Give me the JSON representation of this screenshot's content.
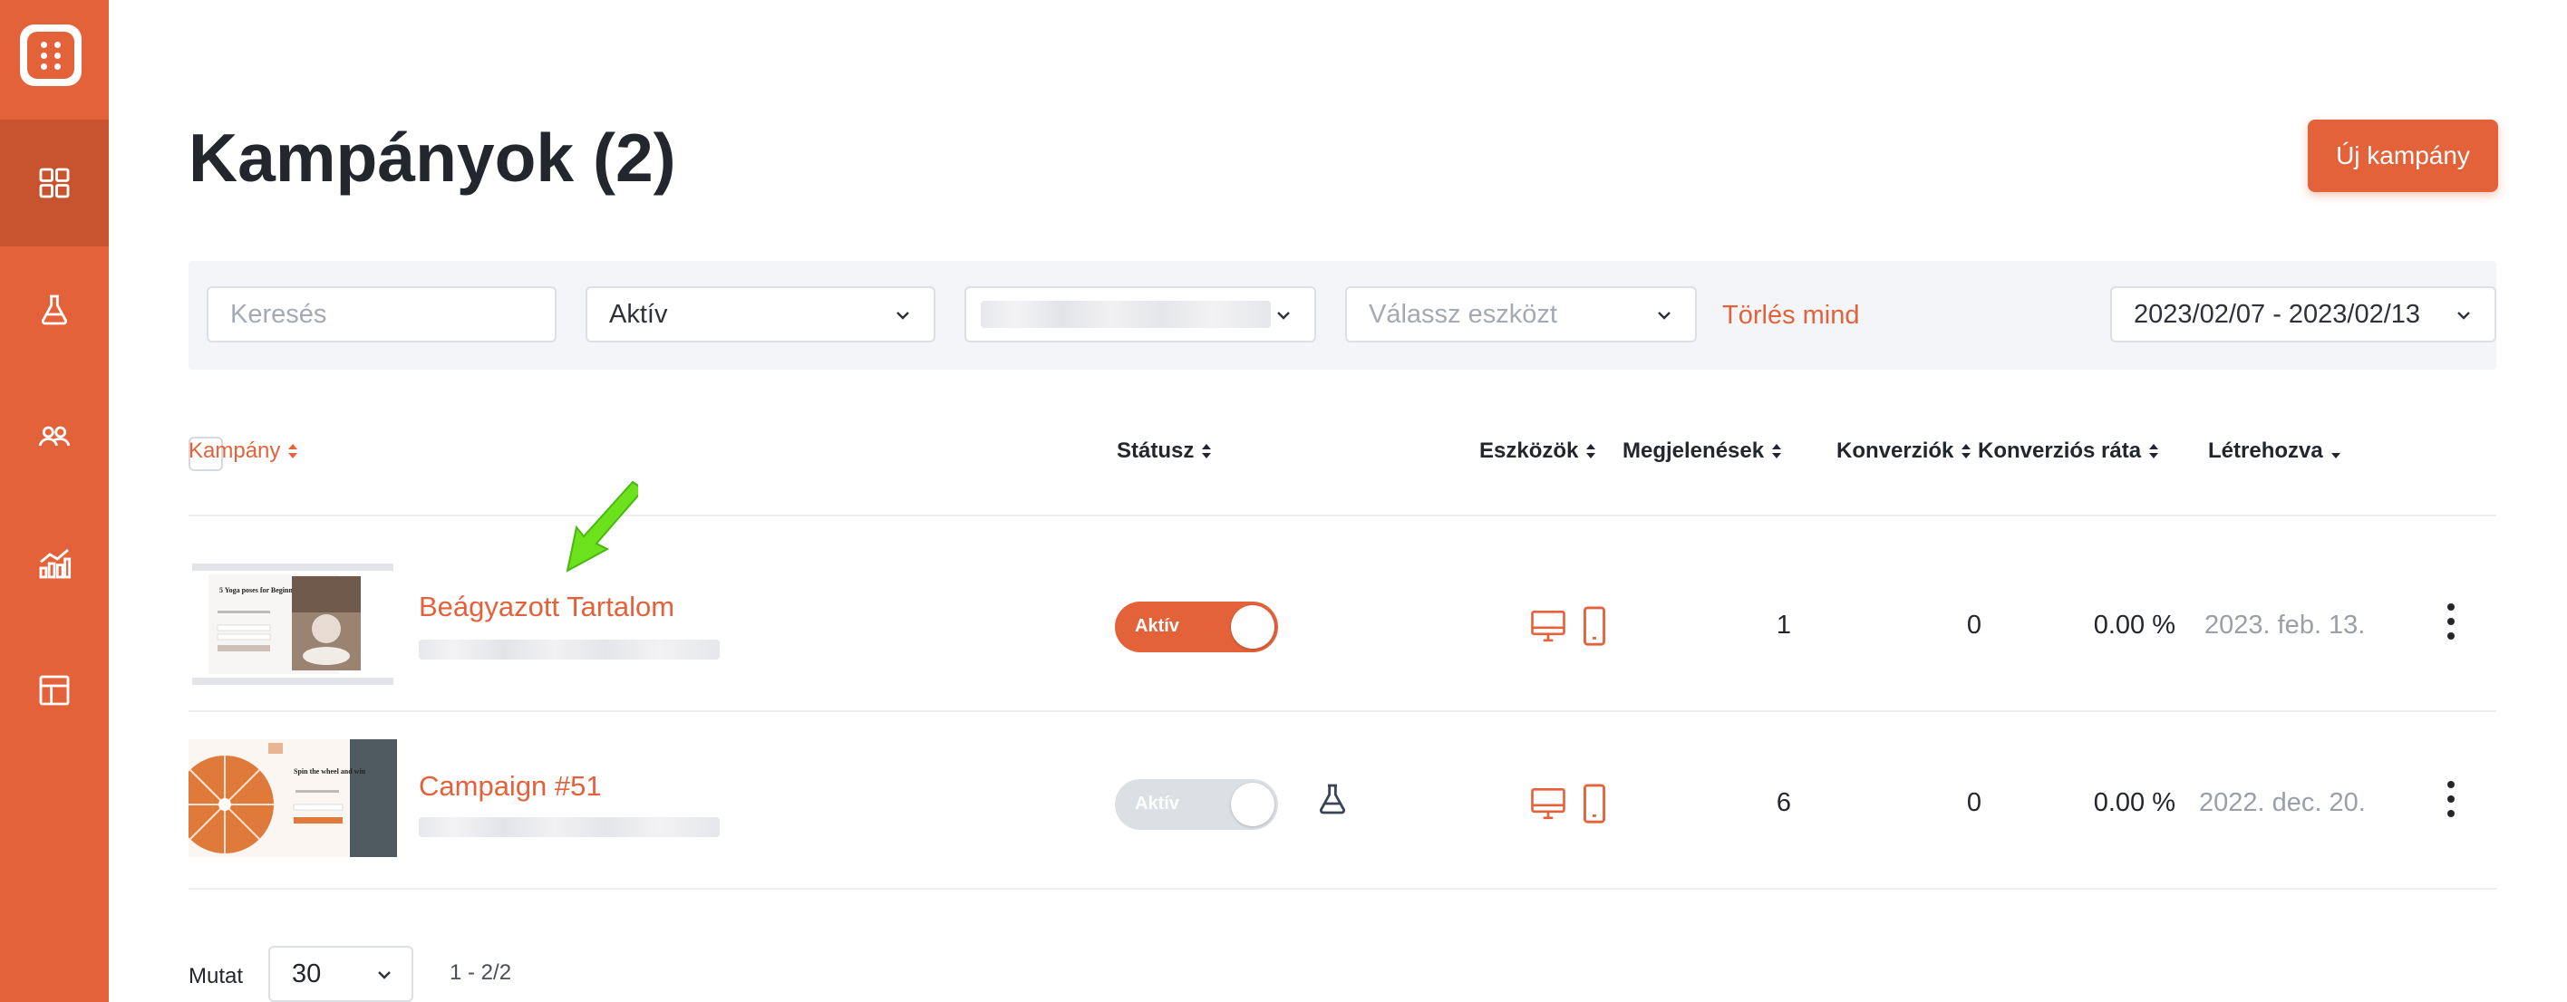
{
  "sidebar": {
    "logo": "dice-app-logo",
    "items": [
      {
        "icon": "dashboard-grid-icon",
        "active": true
      },
      {
        "icon": "flask-icon",
        "active": false
      },
      {
        "icon": "users-icon",
        "active": false
      },
      {
        "icon": "analytics-chart-icon",
        "active": false
      },
      {
        "icon": "layout-template-icon",
        "active": false
      }
    ]
  },
  "header": {
    "title": "Kampányok (2)",
    "new_button": "Új kampány"
  },
  "filters": {
    "search_placeholder": "Keresés",
    "status_value": "Aktív",
    "device_placeholder": "Válassz eszközt",
    "clear_all": "Törlés mind",
    "date_range": "2023/02/07 - 2023/02/13"
  },
  "table": {
    "columns": {
      "campaign": "Kampány",
      "status": "Státusz",
      "devices": "Eszközök",
      "impressions": "Megjelenések",
      "conversions": "Konverziók",
      "conversion_rate": "Konverziós ráta",
      "created": "Létrehozva"
    },
    "rows": [
      {
        "name": "Beágyazott Tartalom",
        "status": "Aktív",
        "active": true,
        "impressions": "1",
        "conversions": "0",
        "conversion_rate": "0.00 %",
        "created": "2023. feb. 13.",
        "thumb_text": "5 Yoga poses for Beginners"
      },
      {
        "name": "Campaign #51",
        "status": "Aktív",
        "active": false,
        "impressions": "6",
        "conversions": "0",
        "conversion_rate": "0.00 %",
        "created": "2022. dec. 20.",
        "thumb_text": "Spin the wheel and win"
      }
    ]
  },
  "footer": {
    "show_label": "Mutat",
    "page_size": "30",
    "range": "1 - 2/2"
  },
  "colors": {
    "accent": "#e4623a",
    "sidebar_active": "#c8532f",
    "arrow": "#6be21c"
  }
}
